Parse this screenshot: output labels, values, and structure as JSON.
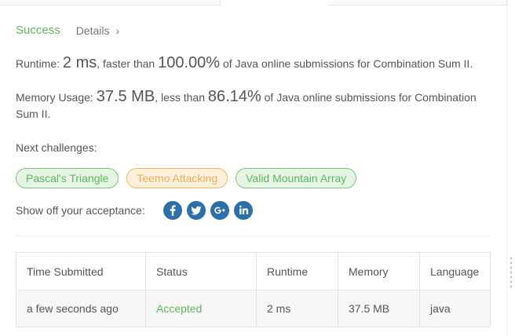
{
  "result": {
    "status": "Success",
    "details_label": "Details",
    "runtime_prefix": "Runtime:",
    "runtime_value": "2 ms",
    "runtime_middle": ", faster than",
    "runtime_percent": "100.00%",
    "runtime_suffix": "of Java online submissions for Combination Sum II.",
    "memory_prefix": "Memory Usage:",
    "memory_value": "37.5 MB",
    "memory_middle": ", less than",
    "memory_percent": "86.14%",
    "memory_suffix": "of Java online submissions for Combination Sum II."
  },
  "next_challenges": {
    "label": "Next challenges:",
    "items": [
      {
        "label": "Pascal's Triangle",
        "difficulty": "easy"
      },
      {
        "label": "Teemo Attacking",
        "difficulty": "medium"
      },
      {
        "label": "Valid Mountain Array",
        "difficulty": "easy"
      }
    ]
  },
  "share": {
    "label": "Show off your acceptance:",
    "icons": [
      "facebook-icon",
      "twitter-icon",
      "google-plus-icon",
      "linkedin-icon"
    ]
  },
  "submissions": {
    "headers": [
      "Time Submitted",
      "Status",
      "Runtime",
      "Memory",
      "Language"
    ],
    "rows": [
      [
        "a few seconds ago",
        "Accepted",
        "2 ms",
        "37.5 MB",
        "java"
      ]
    ]
  },
  "colors": {
    "success": "#5cb85c",
    "medium": "#f0ad4e",
    "share_icon": "#2d6fa8"
  }
}
